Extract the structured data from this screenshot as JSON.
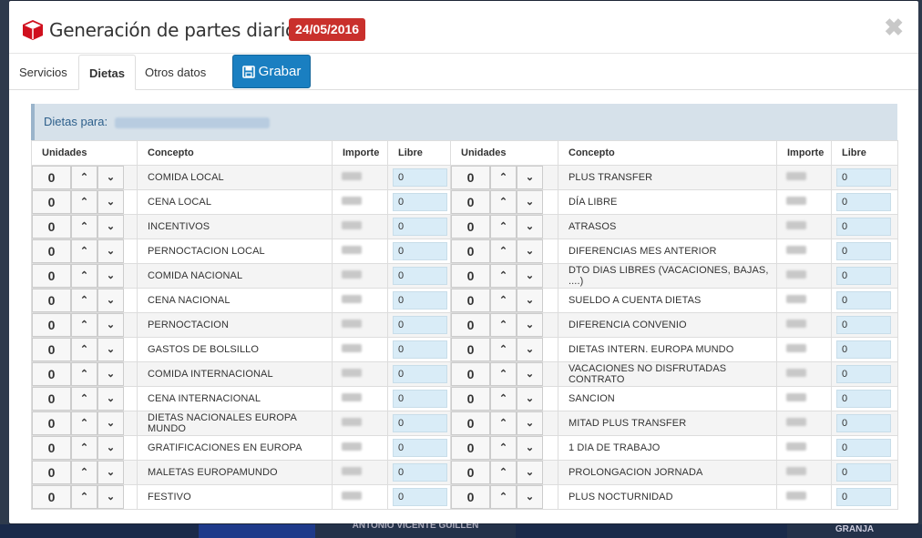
{
  "modal": {
    "title": "Generación de partes diario, dia",
    "date": "24/05/2016",
    "close": "✖"
  },
  "tabs": [
    {
      "label": "Servicios"
    },
    {
      "label": "Dietas"
    },
    {
      "label": "Otros datos"
    }
  ],
  "save_label": "Grabar",
  "panel": {
    "heading": "Dietas para:"
  },
  "headers": {
    "unidades": "Unidades",
    "concepto": "Concepto",
    "importe": "Importe",
    "libre": "Libre"
  },
  "background": {
    "bottom_name": "ANTONIO VICENTE GUILLEN",
    "bottom_right": "GRANJA"
  },
  "left_rows": [
    {
      "units": "0",
      "concept": "COMIDA LOCAL",
      "libre": "0"
    },
    {
      "units": "0",
      "concept": "CENA LOCAL",
      "libre": "0"
    },
    {
      "units": "0",
      "concept": "INCENTIVOS",
      "libre": "0"
    },
    {
      "units": "0",
      "concept": "PERNOCTACION LOCAL",
      "libre": "0"
    },
    {
      "units": "0",
      "concept": "COMIDA NACIONAL",
      "libre": "0"
    },
    {
      "units": "0",
      "concept": "CENA NACIONAL",
      "libre": "0"
    },
    {
      "units": "0",
      "concept": "PERNOCTACION",
      "libre": "0"
    },
    {
      "units": "0",
      "concept": "GASTOS DE BOLSILLO",
      "libre": "0"
    },
    {
      "units": "0",
      "concept": "COMIDA INTERNACIONAL",
      "libre": "0"
    },
    {
      "units": "0",
      "concept": "CENA INTERNACIONAL",
      "libre": "0"
    },
    {
      "units": "0",
      "concept": "DIETAS NACIONALES EUROPA MUNDO",
      "libre": "0"
    },
    {
      "units": "0",
      "concept": "GRATIFICACIONES EN EUROPA",
      "libre": "0"
    },
    {
      "units": "0",
      "concept": "MALETAS EUROPAMUNDO",
      "libre": "0"
    },
    {
      "units": "0",
      "concept": "FESTIVO",
      "libre": "0"
    }
  ],
  "right_rows": [
    {
      "units": "0",
      "concept": "PLUS TRANSFER",
      "libre": "0"
    },
    {
      "units": "0",
      "concept": "DÍA LIBRE",
      "libre": "0"
    },
    {
      "units": "0",
      "concept": "ATRASOS",
      "libre": "0"
    },
    {
      "units": "0",
      "concept": "DIFERENCIAS MES ANTERIOR",
      "libre": "0"
    },
    {
      "units": "0",
      "concept": "DTO DIAS LIBRES (VACACIONES, BAJAS, ....)",
      "libre": "0"
    },
    {
      "units": "0",
      "concept": "SUELDO A CUENTA DIETAS",
      "libre": "0"
    },
    {
      "units": "0",
      "concept": "DIFERENCIA CONVENIO",
      "libre": "0"
    },
    {
      "units": "0",
      "concept": "DIETAS INTERN. EUROPA MUNDO",
      "libre": "0"
    },
    {
      "units": "0",
      "concept": "VACACIONES NO DISFRUTADAS CONTRATO",
      "libre": "0"
    },
    {
      "units": "0",
      "concept": "SANCION",
      "libre": "0"
    },
    {
      "units": "0",
      "concept": "MITAD PLUS TRANSFER",
      "libre": "0"
    },
    {
      "units": "0",
      "concept": "1 DIA DE TRABAJO",
      "libre": "0"
    },
    {
      "units": "0",
      "concept": "PROLONGACION JORNADA",
      "libre": "0"
    },
    {
      "units": "0",
      "concept": "PLUS NOCTURNIDAD",
      "libre": "0"
    }
  ],
  "icons": {
    "up": "⌃",
    "down": "⌄"
  }
}
